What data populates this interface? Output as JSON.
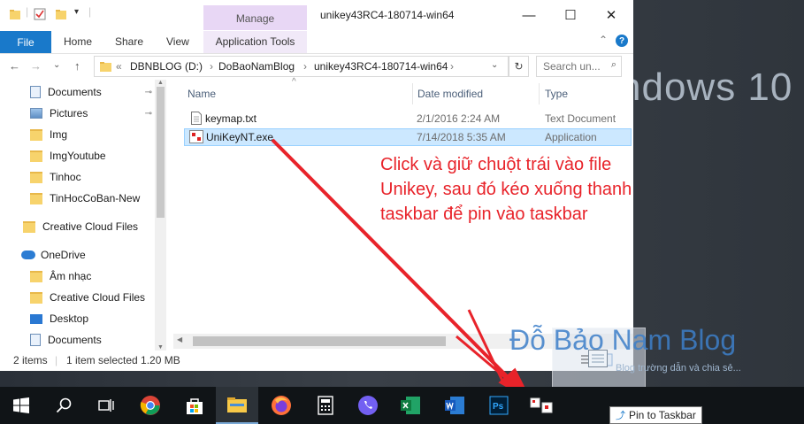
{
  "desktop": {
    "brand_text": "ndows 10"
  },
  "window": {
    "title": "unikey43RC4-180714-win64",
    "manage_tab": "Manage",
    "controls": {
      "minimize": "—",
      "maximize": "☐",
      "close": "✕"
    }
  },
  "ribbon": {
    "file": "File",
    "tabs": [
      "Home",
      "Share",
      "View"
    ],
    "app_tools": "Application Tools",
    "collapse_glyph": "⌃",
    "help_glyph": "?"
  },
  "address": {
    "back": "←",
    "forward": "→",
    "recent": "⌄",
    "up": "↑",
    "crumbs": [
      "«",
      "DBNBLOG (D:)",
      "›",
      "DoBaoNamBlog",
      "›",
      "unikey43RC4-180714-win64",
      "›"
    ],
    "refresh": "↻",
    "search_placeholder": "Search un..."
  },
  "nav": {
    "items": [
      {
        "label": "Documents",
        "icon": "documents-icon",
        "pinned": true
      },
      {
        "label": "Pictures",
        "icon": "pictures-icon",
        "pinned": true
      },
      {
        "label": "Img",
        "icon": "folder-icon"
      },
      {
        "label": "ImgYoutube",
        "icon": "folder-icon"
      },
      {
        "label": "Tinhoc",
        "icon": "folder-icon"
      },
      {
        "label": "TinHocCoBan-New",
        "icon": "folder-icon"
      },
      {
        "label": "Creative Cloud Files",
        "icon": "folder-icon"
      },
      {
        "label": "OneDrive",
        "icon": "onedrive-icon"
      },
      {
        "label": "Âm nhạc",
        "icon": "folder-icon"
      },
      {
        "label": "Creative Cloud Files",
        "icon": "folder-icon"
      },
      {
        "label": "Desktop",
        "icon": "desktop-icon"
      },
      {
        "label": "Documents",
        "icon": "documents-icon"
      }
    ],
    "pin_glyph": "📌"
  },
  "files": {
    "columns": [
      "Name",
      "Date modified",
      "Type"
    ],
    "rows": [
      {
        "name": "keymap.txt",
        "date": "2/1/2016 2:24 AM",
        "type": "Text Document",
        "selected": false
      },
      {
        "name": "UniKeyNT.exe",
        "date": "7/14/2018 5:35 AM",
        "type": "Application",
        "selected": true
      }
    ]
  },
  "status": {
    "count": "2 items",
    "selection": "1 item selected  1.20 MB"
  },
  "annotation": {
    "text": "Click và giữ chuột trái vào file Unikey, sau đó kéo xuống thanh taskbar để pin vào taskbar",
    "color": "#e8232a"
  },
  "watermark": {
    "title": "Đỗ Bảo Nam Blog",
    "subtitle": "Blog trường dẫn và chia sẻ..."
  },
  "taskbar": {
    "apps": [
      "start-icon",
      "search-icon",
      "task-view-icon",
      "chrome-icon",
      "store-icon",
      "file-explorer-icon",
      "firefox-icon",
      "calculator-icon",
      "viber-icon",
      "excel-icon",
      "word-icon",
      "photoshop-icon",
      "unikey-drag-icon"
    ],
    "tooltip": "Pin to Taskbar"
  }
}
